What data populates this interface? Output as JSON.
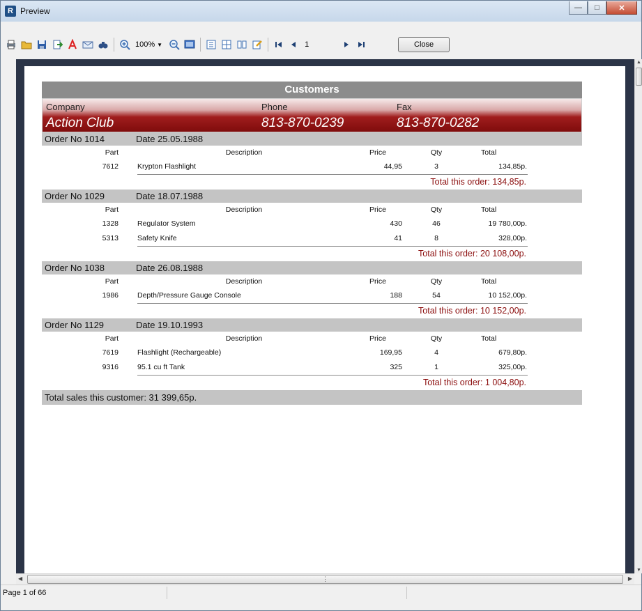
{
  "window": {
    "title": "Preview"
  },
  "toolbar": {
    "zoom": "100%",
    "page_number": "1",
    "close_label": "Close"
  },
  "report": {
    "title": "Customers",
    "labels": {
      "company": "Company",
      "phone": "Phone",
      "fax": "Fax"
    },
    "customer": {
      "company": "Action Club",
      "phone": "813-870-0239",
      "fax": "813-870-0282"
    },
    "columns": {
      "part": "Part",
      "description": "Description",
      "price": "Price",
      "qty": "Qty",
      "total": "Total"
    },
    "orders": [
      {
        "order_no": "Order No 1014",
        "date": "Date 25.05.1988",
        "items": [
          {
            "part": "7612",
            "description": "Krypton Flashlight",
            "price": "44,95",
            "qty": "3",
            "total": "134,85p."
          }
        ],
        "order_total": "Total this order: 134,85p."
      },
      {
        "order_no": "Order No 1029",
        "date": "Date 18.07.1988",
        "items": [
          {
            "part": "1328",
            "description": "Regulator System",
            "price": "430",
            "qty": "46",
            "total": "19 780,00p."
          },
          {
            "part": "5313",
            "description": "Safety Knife",
            "price": "41",
            "qty": "8",
            "total": "328,00p."
          }
        ],
        "order_total": "Total this order: 20 108,00p."
      },
      {
        "order_no": "Order No 1038",
        "date": "Date 26.08.1988",
        "items": [
          {
            "part": "1986",
            "description": "Depth/Pressure Gauge Console",
            "price": "188",
            "qty": "54",
            "total": "10 152,00p."
          }
        ],
        "order_total": "Total this order: 10 152,00p."
      },
      {
        "order_no": "Order No 1129",
        "date": "Date 19.10.1993",
        "items": [
          {
            "part": "7619",
            "description": "Flashlight (Rechargeable)",
            "price": "169,95",
            "qty": "4",
            "total": "679,80p."
          },
          {
            "part": "9316",
            "description": "95.1 cu ft Tank",
            "price": "325",
            "qty": "1",
            "total": "325,00p."
          }
        ],
        "order_total": "Total this order: 1 004,80p."
      }
    ],
    "customer_total": "Total sales this customer: 31 399,65p."
  },
  "status": {
    "page_info": "Page 1 of 66"
  },
  "icons": {
    "print": "print-icon",
    "open": "open-icon",
    "save": "save-icon",
    "export": "export-icon",
    "pdf": "pdf-icon",
    "email": "email-icon",
    "find": "find-icon",
    "zoom_in": "zoom-in-icon",
    "zoom_out": "zoom-out-icon",
    "full_screen": "full-screen-icon",
    "outline": "outline-icon",
    "thumbnails": "thumbnails-icon",
    "page_setup": "page-setup-icon",
    "edit": "edit-icon",
    "first": "first-page-icon",
    "prev": "prev-page-icon",
    "next": "next-page-icon",
    "last": "last-page-icon"
  },
  "colors": {
    "title_band": "#8c8c8c",
    "order_band": "#c4c4c4",
    "accent_red": "#8b0d0d",
    "preview_bg": "#2b3447"
  }
}
